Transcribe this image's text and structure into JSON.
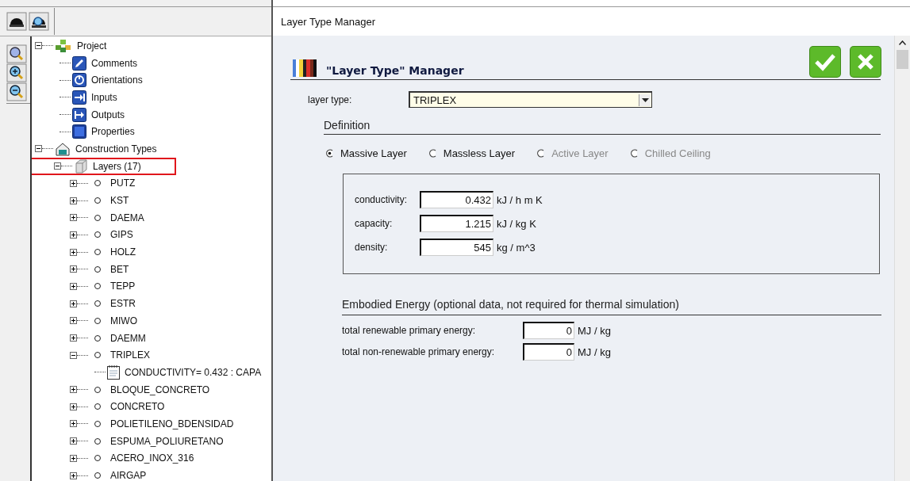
{
  "tree": [
    {
      "label": "Project",
      "kind": "project",
      "expanded": true,
      "children": [
        {
          "label": "Comments",
          "kind": "comments"
        },
        {
          "label": "Orientations",
          "kind": "orientations"
        },
        {
          "label": "Inputs",
          "kind": "inputs"
        },
        {
          "label": "Outputs",
          "kind": "outputs"
        },
        {
          "label": "Properties",
          "kind": "properties"
        }
      ]
    },
    {
      "label": "Construction Types",
      "kind": "construction",
      "expanded": true,
      "children": [
        {
          "label": "Layers (17)",
          "kind": "layers",
          "expanded": true,
          "highlighted": true,
          "children": [
            {
              "label": "PUTZ",
              "kind": "layer",
              "expanded": false
            },
            {
              "label": "KST",
              "kind": "layer",
              "expanded": false
            },
            {
              "label": "DAEMA",
              "kind": "layer",
              "expanded": false
            },
            {
              "label": "GIPS",
              "kind": "layer",
              "expanded": false
            },
            {
              "label": "HOLZ",
              "kind": "layer",
              "expanded": false
            },
            {
              "label": "BET",
              "kind": "layer",
              "expanded": false
            },
            {
              "label": "TEPP",
              "kind": "layer",
              "expanded": false
            },
            {
              "label": "ESTR",
              "kind": "layer",
              "expanded": false
            },
            {
              "label": "MIWO",
              "kind": "layer",
              "expanded": false
            },
            {
              "label": "DAEMM",
              "kind": "layer",
              "expanded": false
            },
            {
              "label": "TRIPLEX",
              "kind": "layer",
              "expanded": true,
              "children": [
                {
                  "label": "CONDUCTIVITY=  0.432 : CAPA",
                  "kind": "note"
                }
              ]
            },
            {
              "label": "BLOQUE_CONCRETO",
              "kind": "layer",
              "expanded": false
            },
            {
              "label": "CONCRETO",
              "kind": "layer",
              "expanded": false
            },
            {
              "label": "POLIETILENO_BDENSIDAD",
              "kind": "layer",
              "expanded": false
            },
            {
              "label": "ESPUMA_POLIURETANO",
              "kind": "layer",
              "expanded": false
            },
            {
              "label": "ACERO_INOX_316",
              "kind": "layer",
              "expanded": false
            },
            {
              "label": "AIRGAP",
              "kind": "layer",
              "expanded": false
            }
          ]
        }
      ]
    }
  ],
  "window": {
    "title": "Layer Type Manager"
  },
  "manager": {
    "heading": "\"Layer Type\" Manager",
    "layer_type": {
      "label": "layer type:",
      "value": "TRIPLEX"
    },
    "definition": {
      "title": "Definition",
      "options": [
        {
          "label": "Massive Layer",
          "selected": true,
          "disabled": false
        },
        {
          "label": "Massless Layer",
          "selected": false,
          "disabled": false
        },
        {
          "label": "Active Layer",
          "selected": false,
          "disabled": true
        },
        {
          "label": "Chilled Ceiling",
          "selected": false,
          "disabled": true
        }
      ]
    },
    "properties": [
      {
        "label": "conductivity:",
        "value": "0.432",
        "unit": "kJ / h m K"
      },
      {
        "label": "capacity:",
        "value": "1.215",
        "unit": "kJ / kg K"
      },
      {
        "label": "density:",
        "value": "545",
        "unit": "kg / m^3"
      }
    ],
    "embodied": {
      "title": "Embodied Energy (optional data, not required for thermal simulation)",
      "fields": [
        {
          "label": "total renewable primary energy:",
          "value": "0",
          "unit": "MJ / kg"
        },
        {
          "label": "total non-renewable primary energy:",
          "value": "0",
          "unit": "MJ / kg"
        }
      ]
    }
  }
}
